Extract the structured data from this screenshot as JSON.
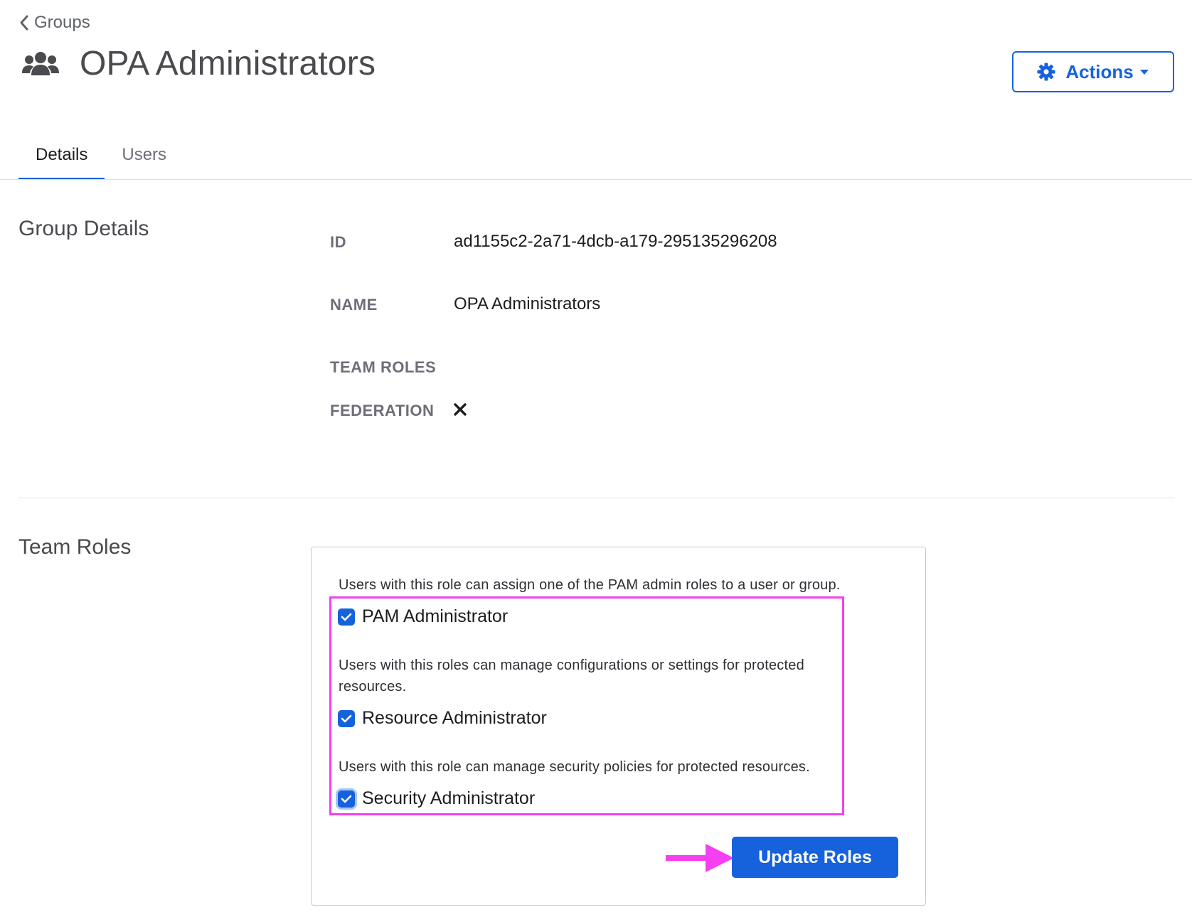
{
  "breadcrumb": {
    "back_label": "Groups"
  },
  "header": {
    "title": "OPA Administrators",
    "actions_label": "Actions"
  },
  "tabs": [
    {
      "label": "Details",
      "active": true
    },
    {
      "label": "Users",
      "active": false
    }
  ],
  "group_details": {
    "section_title": "Group Details",
    "fields": {
      "id_label": "ID",
      "id_value": "ad1155c2-2a71-4dcb-a179-295135296208",
      "name_label": "NAME",
      "name_value": "OPA Administrators",
      "team_roles_label": "TEAM ROLES",
      "federation_label": "FEDERATION",
      "federation_icon": "x-icon"
    }
  },
  "team_roles": {
    "section_title": "Team Roles",
    "roles": [
      {
        "description": "Users with this role can assign one of the PAM admin roles to a user or group.",
        "label": "PAM Administrator",
        "checked": true
      },
      {
        "description": "Users with this roles can manage configurations or settings for protected resources.",
        "label": "Resource Administrator",
        "checked": true
      },
      {
        "description": "Users with this role can manage security policies for protected resources.",
        "label": "Security Administrator",
        "checked": true
      }
    ],
    "update_label": "Update Roles"
  },
  "colors": {
    "accent": "#1662dd",
    "annotation": "#f53ff0",
    "divider": "#e0e0e4"
  }
}
